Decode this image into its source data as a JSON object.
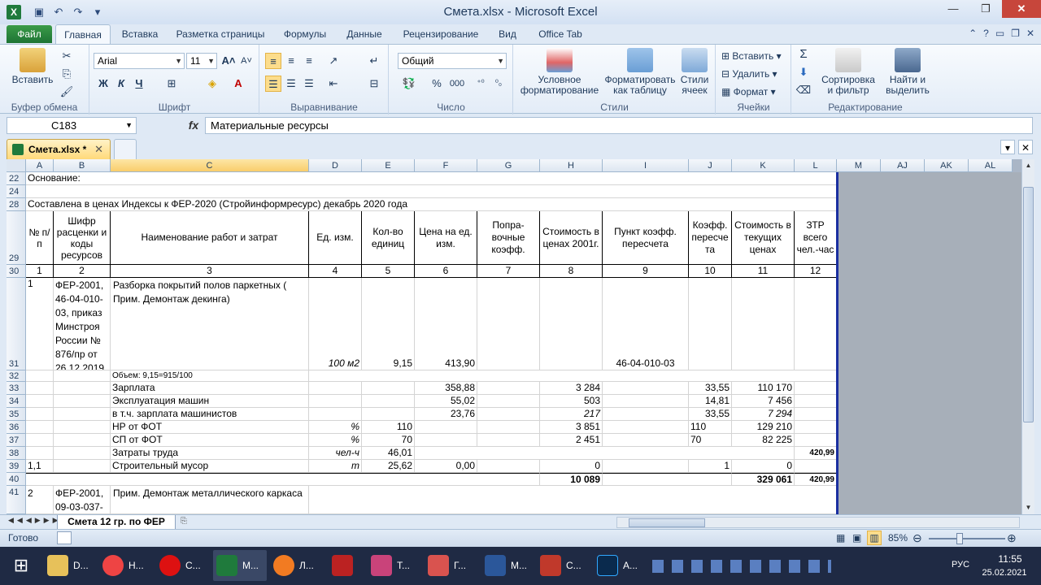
{
  "window": {
    "title": "Смета.xlsx - Microsoft Excel"
  },
  "ribbon_tabs": {
    "file": "Файл",
    "items": [
      "Главная",
      "Вставка",
      "Разметка страницы",
      "Формулы",
      "Данные",
      "Рецензирование",
      "Вид",
      "Office Tab"
    ]
  },
  "ribbon": {
    "clipboard": {
      "label": "Буфер обмена",
      "paste": "Вставить"
    },
    "font": {
      "label": "Шрифт",
      "name": "Arial",
      "size": "11",
      "bold": "Ж",
      "italic": "К",
      "underline": "Ч"
    },
    "alignment": {
      "label": "Выравнивание"
    },
    "number": {
      "label": "Число",
      "format": "Общий",
      "percent": "%",
      "thousands": "000"
    },
    "styles": {
      "label": "Стили",
      "conditional": "Условное форматирование",
      "table": "Форматировать как таблицу",
      "cell_styles": "Стили ячеек"
    },
    "cells": {
      "label": "Ячейки",
      "insert": "Вставить",
      "delete": "Удалить",
      "format": "Формат"
    },
    "editing": {
      "label": "Редактирование",
      "sort": "Сортировка и фильтр",
      "find": "Найти и выделить",
      "sigma": "Σ"
    }
  },
  "formula_bar": {
    "name_box": "C183",
    "fx": "fx",
    "formula": "Материальные ресурсы"
  },
  "doc_tab": {
    "name": "Смета.xlsx *"
  },
  "columns": [
    "A",
    "B",
    "C",
    "D",
    "E",
    "F",
    "G",
    "H",
    "I",
    "J",
    "K",
    "L",
    "M",
    "AJ",
    "AK",
    "AL"
  ],
  "rows": {
    "r22": {
      "num": "22",
      "a": "Основание:"
    },
    "r24": {
      "num": "24"
    },
    "r28": {
      "num": "28",
      "a": "Составлена в ценах Индексы к ФЕР-2020 (Стройинформресурс)  декабрь 2020 года"
    },
    "r29": {
      "num": "29",
      "a": "№ п/п",
      "b": "Шифр расценки и коды ресурсов",
      "c": "Наименование работ и затрат",
      "d": "Ед. изм.",
      "e": "Кол-во единиц",
      "f": "Цена на ед. изм.",
      "g": "Попра-вочные коэфф.",
      "h": "Стоимость в ценах 2001г.",
      "i": "Пункт коэфф. пересчета",
      "j": "Коэфф. пересче та",
      "k": "Стоимость в текущих ценах",
      "l": "ЗТР всего чел.-час"
    },
    "r30": {
      "num": "30",
      "vals": [
        "1",
        "2",
        "3",
        "4",
        "5",
        "6",
        "7",
        "8",
        "9",
        "10",
        "11",
        "12"
      ]
    },
    "r31": {
      "num": "31",
      "a": "1",
      "b": "ФЕР-2001, 46-04-010-03, приказ Минстроя России № 876/пр от 26.12.2019",
      "c": "Разборка покрытий полов паркетных ( Прим. Демонтаж декинга)",
      "d": "100 м2",
      "e": "9,15",
      "f": "413,90",
      "i": "46-04-010-03"
    },
    "r32": {
      "num": "32",
      "c": "Объем: 9,15=915/100"
    },
    "r33": {
      "num": "33",
      "c": "Зарплата",
      "f": "358,88",
      "h": "3 284",
      "j": "33,55",
      "k": "110 170"
    },
    "r34": {
      "num": "34",
      "c": "Эксплуатация машин",
      "f": "55,02",
      "h": "503",
      "j": "14,81",
      "k": "7 456"
    },
    "r35": {
      "num": "35",
      "c": "в т.ч. зарплата машинистов",
      "f": "23,76",
      "h": "217",
      "j": "33,55",
      "k": "7 294"
    },
    "r36": {
      "num": "36",
      "c": "НР от ФОТ",
      "d": "%",
      "e": "110",
      "h": "3 851",
      "j": "110",
      "k": "129 210"
    },
    "r37": {
      "num": "37",
      "c": "СП от ФОТ",
      "d": "%",
      "e": "70",
      "h": "2 451",
      "j": "70",
      "k": "82 225"
    },
    "r38": {
      "num": "38",
      "c": "Затраты труда",
      "d": "чел-ч",
      "e": "46,01",
      "l": "420,99"
    },
    "r39": {
      "num": "39",
      "a": "1,1",
      "c": "Строительный мусор",
      "d": "т",
      "e": "25,62",
      "f": "0,00",
      "h": "0",
      "j": "1",
      "k": "0"
    },
    "r40": {
      "num": "40",
      "h": "10 089",
      "k": "329 061",
      "l": "420,99"
    },
    "r41": {
      "num": "41",
      "a": "2",
      "b": "ФЕР-2001, 09-03-037-",
      "c": "Прим. Демонтаж металлического каркаса"
    }
  },
  "sheet_tab": {
    "name": "Смета 12 гр. по ФЕР"
  },
  "status": {
    "ready": "Готово",
    "zoom": "85%"
  },
  "taskbar": {
    "items": [
      "D...",
      "Н...",
      "С...",
      "М...",
      "Л...",
      "Т...",
      "Г...",
      "М...",
      "С...",
      "А..."
    ],
    "lang": "РУС",
    "time": "11:55",
    "date": "25.02.2021"
  },
  "colors": {
    "accent": "#1f7a3c",
    "title_bg": "#dfe9f5",
    "selected_col": "#f9cd6b"
  }
}
